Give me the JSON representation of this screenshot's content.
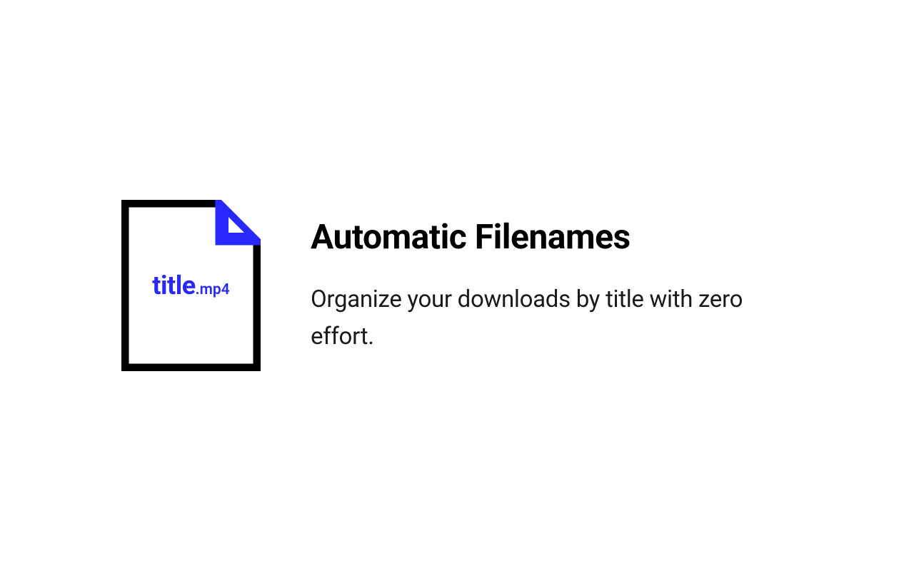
{
  "icon": {
    "title_text": "title",
    "extension_text": ".mp4"
  },
  "heading": "Automatic Filenames",
  "description": "Organize your downloads by title with zero effort."
}
